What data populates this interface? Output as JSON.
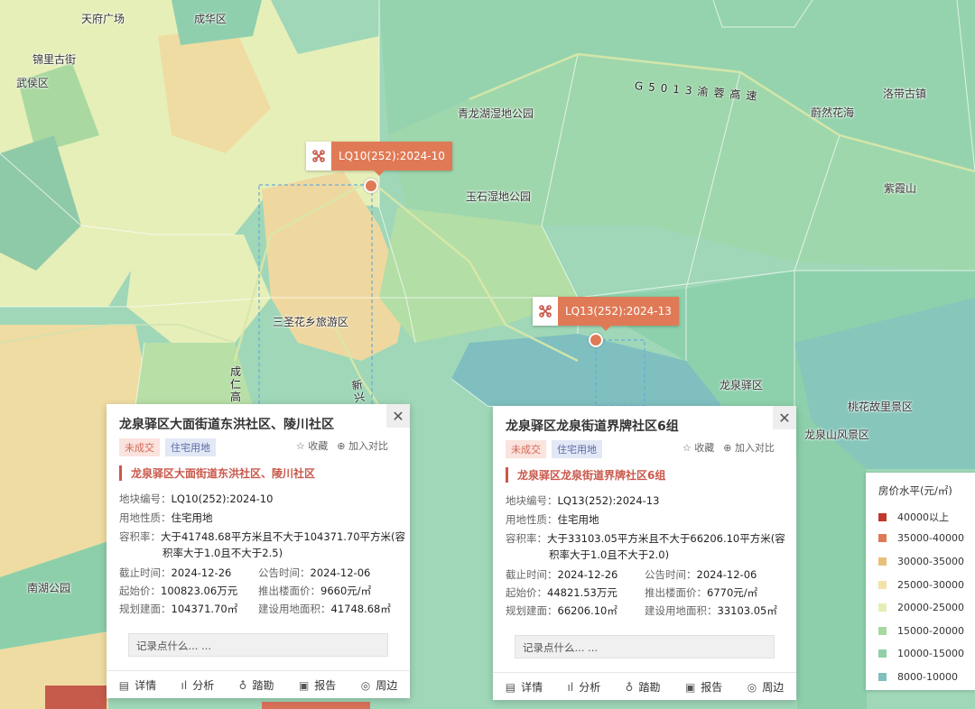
{
  "places": [
    {
      "text": "天府广场"
    },
    {
      "text": "成华区"
    },
    {
      "text": "锦里古街"
    },
    {
      "text": "武侯区"
    },
    {
      "text": "青龙湖湿地公园"
    },
    {
      "text": "玉石湿地公园"
    },
    {
      "text": "蔚然花海"
    },
    {
      "text": "洛带古镇"
    },
    {
      "text": "紫霞山"
    },
    {
      "text": "三圣花乡旅游区"
    },
    {
      "text": "龙泉驿区"
    },
    {
      "text": "桃花故里景区"
    },
    {
      "text": "龙泉山风景区"
    },
    {
      "text": "南湖公园"
    }
  ],
  "roads": {
    "g5013": "G5013渝蓉高速",
    "chengren": "成仁高",
    "xin": "新兴"
  },
  "markers": [
    {
      "label": "LQ10(252):2024-10"
    },
    {
      "label": "LQ13(252):2024-13"
    }
  ],
  "popups": [
    {
      "title": "龙泉驿区大面街道东洪社区、陵川社区",
      "status": "未成交",
      "landtype": "住宅用地",
      "fav": "☆ 收藏",
      "compare": "⊕ 加入对比",
      "subtitle": "龙泉驿区大面街道东洪社区、陵川社区",
      "id_label": "地块编号：",
      "id": "LQ10(252):2024-10",
      "use_label": "用地性质：",
      "use": "住宅用地",
      "far_label": "容积率：",
      "far1": "大于41748.68平方米且不大于104371.70平方米(容",
      "far2": "积率大于1.0且不大于2.5)",
      "deadline_label": "截止时间：",
      "deadline": "2024-12-26",
      "notice_label": "公告时间：",
      "notice": "2024-12-06",
      "start_label": "起始价：",
      "start": "100823.06万元",
      "floor_label": "推出楼面价：",
      "floor": "9660元/㎡",
      "plan_label": "规划建面：",
      "plan": "104371.70㎡",
      "area_label": "建设用地面积：",
      "area": "41748.68㎡",
      "note": "记录点什么... ...",
      "actions": [
        "详情",
        "分析",
        "踏勘",
        "报告",
        "周边"
      ]
    },
    {
      "title": "龙泉驿区龙泉街道界牌社区6组",
      "status": "未成交",
      "landtype": "住宅用地",
      "fav": "☆ 收藏",
      "compare": "⊕ 加入对比",
      "subtitle": "龙泉驿区龙泉街道界牌社区6组",
      "id_label": "地块编号：",
      "id": "LQ13(252):2024-13",
      "use_label": "用地性质：",
      "use": "住宅用地",
      "far_label": "容积率：",
      "far1": "大于33103.05平方米且不大于66206.10平方米(容",
      "far2": "积率大于1.0且不大于2.0)",
      "deadline_label": "截止时间：",
      "deadline": "2024-12-26",
      "notice_label": "公告时间：",
      "notice": "2024-12-06",
      "start_label": "起始价：",
      "start": "44821.53万元",
      "floor_label": "推出楼面价：",
      "floor": "6770元/㎡",
      "plan_label": "规划建面：",
      "plan": "66206.10㎡",
      "area_label": "建设用地面积：",
      "area": "33103.05㎡",
      "note": "记录点什么... ...",
      "actions": [
        "详情",
        "分析",
        "踏勘",
        "报告",
        "周边"
      ]
    }
  ],
  "legend": {
    "title": "房价水平(元/㎡)",
    "items": [
      {
        "label": "40000以上",
        "color": "#c0392b"
      },
      {
        "label": "35000-40000",
        "color": "#e07a56"
      },
      {
        "label": "30000-35000",
        "color": "#e8c07a"
      },
      {
        "label": "25000-30000",
        "color": "#f1e2a6"
      },
      {
        "label": "20000-25000",
        "color": "#e4eeb4"
      },
      {
        "label": "15000-20000",
        "color": "#a9d9a0"
      },
      {
        "label": "10000-15000",
        "color": "#8fd0a8"
      },
      {
        "label": "8000-10000",
        "color": "#7dc0bc"
      }
    ]
  }
}
